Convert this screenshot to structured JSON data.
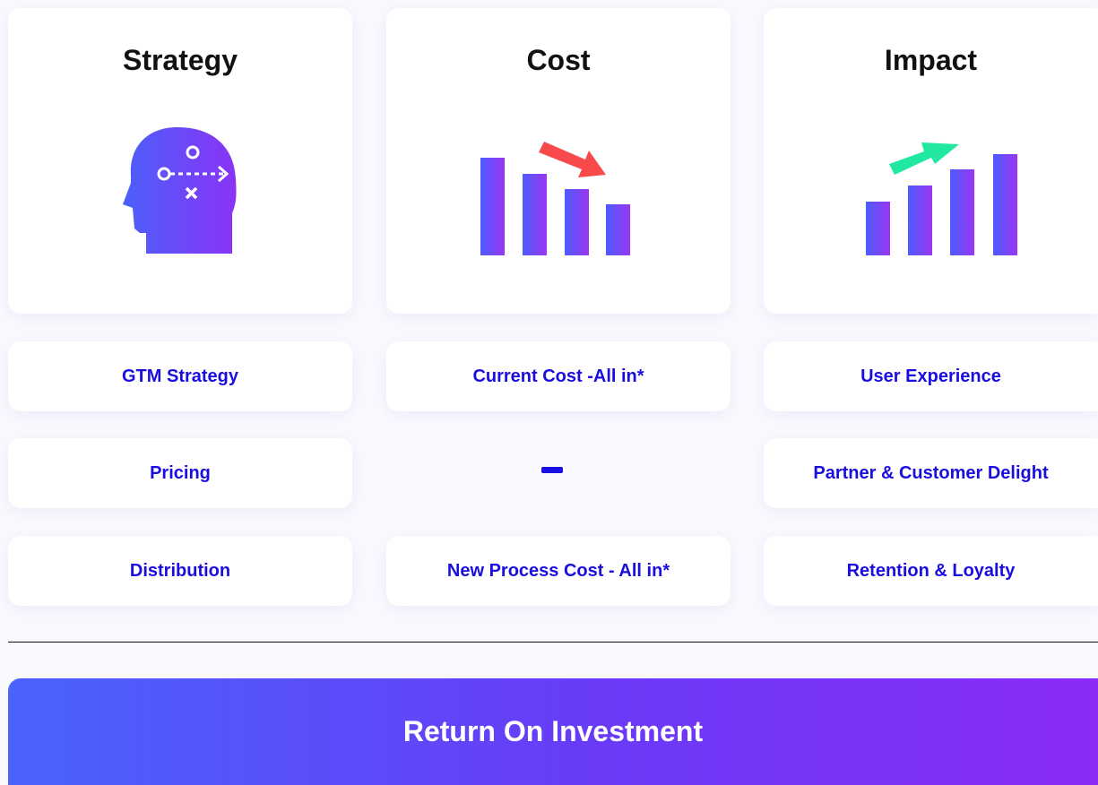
{
  "columns": [
    {
      "title": "Strategy",
      "icon": "head-strategy-icon"
    },
    {
      "title": "Cost",
      "icon": "bar-chart-down-icon"
    },
    {
      "title": "Impact",
      "icon": "bar-chart-up-icon"
    }
  ],
  "rows": {
    "strategy": [
      "GTM Strategy",
      "Pricing",
      "Distribution"
    ],
    "cost": [
      "Current Cost -All in*",
      "New Process Cost - All in*"
    ],
    "impact": [
      "User Experience",
      "Partner & Customer Delight",
      "Retention & Loyalty"
    ]
  },
  "roi_button": {
    "label": "Return On Investment"
  },
  "colors": {
    "accent_text": "#1a0de0",
    "gradient_start": "#4963fb",
    "gradient_end": "#8a2bf6",
    "down_arrow": "#f84a4a",
    "up_arrow": "#21e8a0"
  }
}
